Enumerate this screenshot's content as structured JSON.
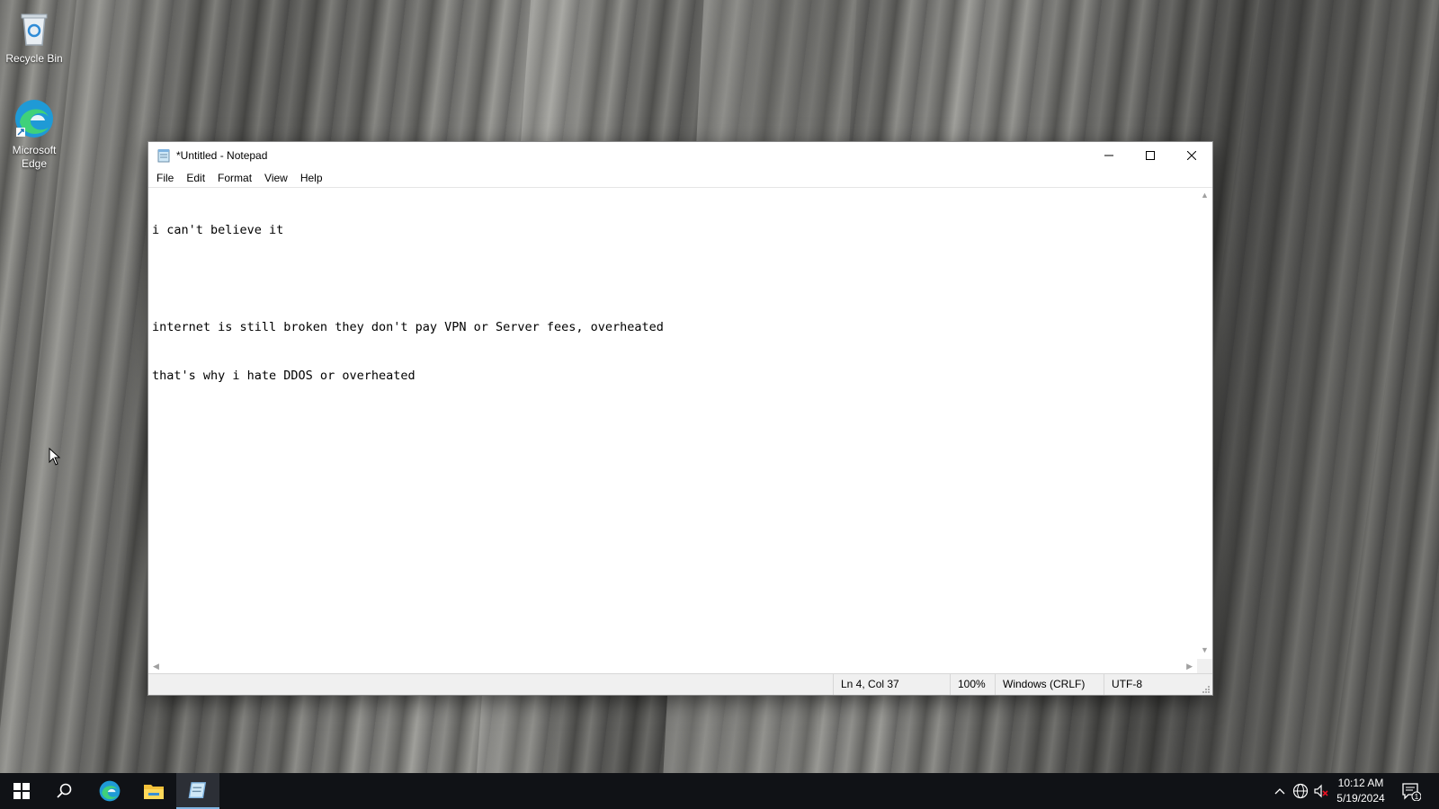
{
  "desktop": {
    "icons": [
      {
        "label": "Recycle Bin",
        "icon": "recycle-bin-icon"
      },
      {
        "label": "Microsoft Edge",
        "icon": "edge-icon"
      }
    ]
  },
  "window": {
    "title": "*Untitled - Notepad",
    "menu": [
      "File",
      "Edit",
      "Format",
      "View",
      "Help"
    ],
    "editor_lines": [
      "i can't believe it",
      "",
      "internet is still broken they don't pay VPN or Server fees, overheated",
      "that's why i hate DDOS or overheated"
    ],
    "status": {
      "position": "Ln 4, Col 37",
      "zoom": "100%",
      "line_ending": "Windows (CRLF)",
      "encoding": "UTF-8"
    }
  },
  "taskbar": {
    "apps": [
      "start-icon",
      "search-icon",
      "edge-icon",
      "file-explorer-icon",
      "notepad-icon"
    ],
    "active_app": "notepad-icon",
    "clock": {
      "time": "10:12 AM",
      "date": "5/19/2024"
    },
    "notification_count": "1"
  },
  "colors": {
    "taskbar_bg": "#101216",
    "active_indicator": "#7fb3e0",
    "statusbar_bg": "#f0f0f0"
  }
}
